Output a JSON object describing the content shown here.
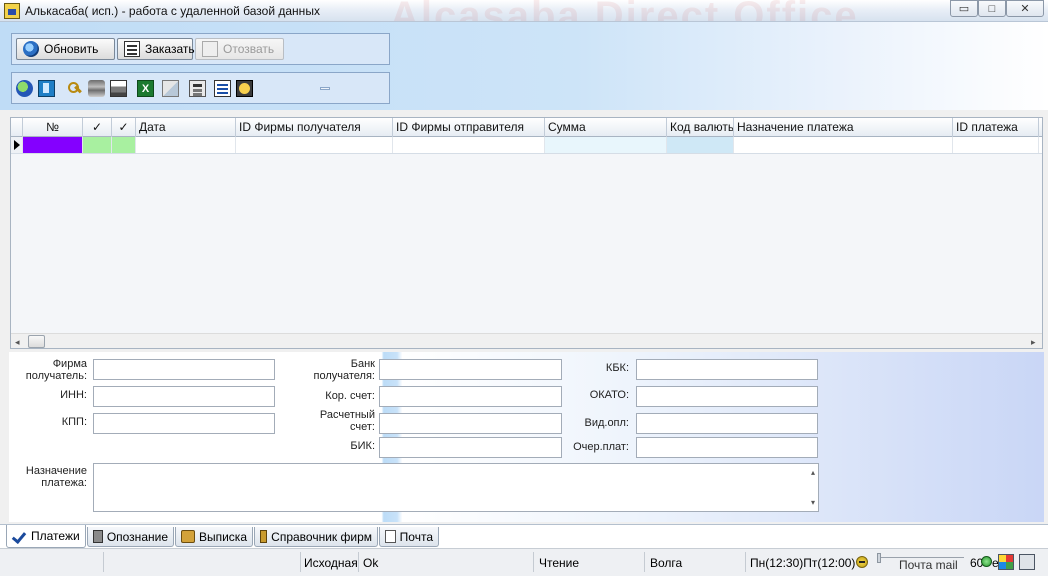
{
  "window": {
    "title": "Алькасаба( исп.) - работа с удаленной базой данных",
    "minimize": "▭",
    "restore": "□",
    "close": "✕"
  },
  "toolbar": {
    "refresh_label": "Обновить",
    "order_label": "Заказать",
    "recall_label": "Отозвать",
    "recall_disabled": true,
    "icons": [
      "globe-icon",
      "book-icon",
      "keys-icon",
      "database-icon",
      "printer-icon",
      "excel-icon",
      "copy-icon",
      "calculator-icon",
      "list-icon",
      "clock-icon"
    ],
    "excel_glyph": "X"
  },
  "grid": {
    "columns": [
      {
        "label": "№"
      },
      {
        "label": "✓"
      },
      {
        "label": "✓"
      },
      {
        "label": "Дата"
      },
      {
        "label": "ID Фирмы получателя"
      },
      {
        "label": "ID Фирмы отправителя"
      },
      {
        "label": "Сумма"
      },
      {
        "label": "Код валюты"
      },
      {
        "label": "Назначение платежа"
      },
      {
        "label": "ID платежа"
      }
    ],
    "rows": [
      {
        "cells": [
          "",
          "",
          "",
          "",
          "",
          "",
          "",
          "",
          "",
          ""
        ]
      }
    ],
    "colors": {
      "number_cell": "#8400ff",
      "check_cell": "#a8f0a0",
      "sum_cell": "#e8f6fc",
      "currency_cell": "#cfe8f6"
    },
    "scroll_left": "◂",
    "scroll_right": "▸"
  },
  "detail": {
    "recipient_firm_label": "Фирма получатель:",
    "inn_label": "ИНН:",
    "kpp_label": "КПП:",
    "recipient_bank_label": "Банк получателя:",
    "corr_account_label": "Кор. счет:",
    "settlement_account_label": "Расчетный счет:",
    "bik_label": "БИК:",
    "kbk_label": "КБК:",
    "okato_label": "ОКАТО:",
    "payment_type_label": "Вид.опл:",
    "payment_order_label": "Очер.плат:",
    "purpose_label": "Назначение платежа:",
    "values": {
      "recipient_firm": "",
      "inn": "",
      "kpp": "",
      "recipient_bank": "",
      "corr_account": "",
      "settlement_account": "",
      "bik": "",
      "kbk": "",
      "okato": "",
      "payment_type": "",
      "payment_order": "",
      "purpose": ""
    },
    "scroll_up": "▴",
    "scroll_down": "▾"
  },
  "tabs": [
    {
      "label": "Платежи",
      "icon": "check-icon",
      "active": true
    },
    {
      "label": "Опознание",
      "icon": "document-icon",
      "active": false
    },
    {
      "label": "Выписка",
      "icon": "bag-icon",
      "active": false
    },
    {
      "label": "Справочник фирм",
      "icon": "cabinet-icon",
      "active": false
    },
    {
      "label": "Почта",
      "icon": "mail-icon",
      "active": false
    }
  ],
  "status": {
    "source": "Исходная",
    "result": "Ok",
    "mode": "Чтение",
    "server": "Волга",
    "schedule": "Пн(12:30)Пт(12:00)",
    "mail": "Почта mail",
    "zoom": "60",
    "zoom_suffix": "e"
  }
}
